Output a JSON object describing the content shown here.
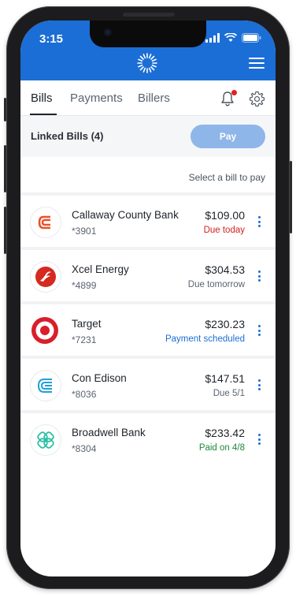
{
  "status": {
    "time": "3:15"
  },
  "tabs": [
    {
      "label": "Bills",
      "active": true
    },
    {
      "label": "Payments",
      "active": false
    },
    {
      "label": "Billers",
      "active": false
    }
  ],
  "linked": {
    "title": "Linked Bills (4)",
    "pay_label": "Pay"
  },
  "hint": "Select a bill to pay",
  "bills": [
    {
      "name": "Callaway County Bank",
      "account": "*3901",
      "amount": "$109.00",
      "status": "Due today",
      "status_color": "#d32020",
      "icon": "callaway-logo-icon"
    },
    {
      "name": "Xcel Energy",
      "account": "*4899",
      "amount": "$304.53",
      "status": "Due tomorrow",
      "status_color": "#5b6470",
      "icon": "xcel-logo-icon"
    },
    {
      "name": "Target",
      "account": "*7231",
      "amount": "$230.23",
      "status": "Payment scheduled",
      "status_color": "#1b6ed6",
      "icon": "target-logo-icon"
    },
    {
      "name": "Con Edison",
      "account": "*8036",
      "amount": "$147.51",
      "status": "Due 5/1",
      "status_color": "#5b6470",
      "icon": "con-edison-logo-icon"
    },
    {
      "name": "Broadwell Bank",
      "account": "*8304",
      "amount": "$233.42",
      "status": "Paid on 4/8",
      "status_color": "#1f8a3a",
      "icon": "broadwell-logo-icon"
    }
  ],
  "colors": {
    "brand": "#1b6ed6",
    "pay_button": "#8fb6e8",
    "notification_dot": "#e02020"
  }
}
